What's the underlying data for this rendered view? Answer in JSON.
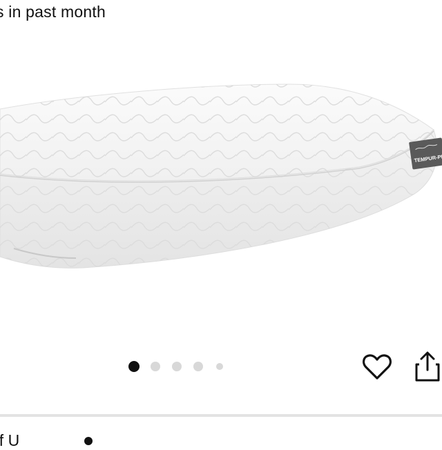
{
  "header": {
    "purchase_text": "s in past month"
  },
  "product_image": {
    "icon": "pillow-image",
    "tag_text": "TEMPUR-PEDIC"
  },
  "carousel": {
    "total_dots": 5,
    "active_index": 0
  },
  "actions": {
    "favorite_icon": "heart-icon",
    "share_icon": "share-icon"
  },
  "footer": {
    "partial_text": "of U"
  }
}
